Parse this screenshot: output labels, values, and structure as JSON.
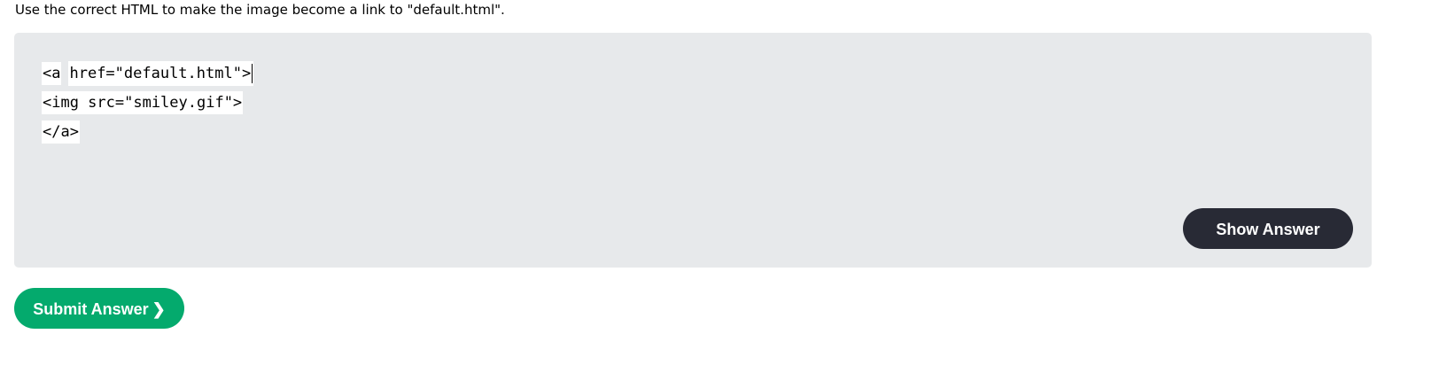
{
  "instruction": "Use the correct HTML to make the image become a link to \"default.html\".",
  "code": {
    "line1_prefix": "<a",
    "line1_input": "href=\"default.html\">",
    "line2": "<img src=\"smiley.gif\">",
    "line3": "</a>"
  },
  "buttons": {
    "show_answer": "Show Answer",
    "submit_answer": "Submit Answer",
    "submit_chevron": "❯"
  },
  "colors": {
    "exercise_bg": "#e7e9eb",
    "show_answer_bg": "#282a35",
    "submit_bg": "#04aa6d"
  }
}
